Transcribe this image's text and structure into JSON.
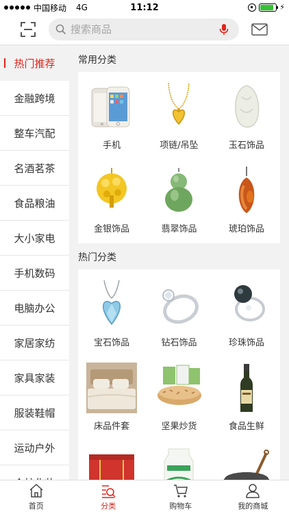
{
  "status_bar": {
    "carrier": "中国移动",
    "network": "4G",
    "time": "11:12",
    "battery_level": 0.85,
    "battery_color": "#33c233"
  },
  "header": {
    "search_placeholder": "搜索商品",
    "scan_icon": "scan-icon",
    "mic_icon": "microphone-icon",
    "message_icon": "mail-icon"
  },
  "colors": {
    "accent": "#e2231a",
    "background": "#f2f2f2"
  },
  "sidebar": {
    "items": [
      {
        "label": "热门推荐",
        "active": true
      },
      {
        "label": "金融跨境"
      },
      {
        "label": "整车汽配"
      },
      {
        "label": "名酒茗茶"
      },
      {
        "label": "食品粮油"
      },
      {
        "label": "大小家电"
      },
      {
        "label": "手机数码"
      },
      {
        "label": "电脑办公"
      },
      {
        "label": "家居家纺"
      },
      {
        "label": "家具家装"
      },
      {
        "label": "服装鞋帽"
      },
      {
        "label": "运动户外"
      },
      {
        "label": "个护化妆"
      }
    ]
  },
  "common": {
    "title": "常用分类",
    "items": [
      {
        "label": "手机",
        "icon": "smartphone-image"
      },
      {
        "label": "项链/吊坠",
        "icon": "heart-necklace-image"
      },
      {
        "label": "玉石饰品",
        "icon": "jade-pendant-image"
      },
      {
        "label": "金银饰品",
        "icon": "gold-tree-pendant-image"
      },
      {
        "label": "翡翠饰品",
        "icon": "jadeite-gourd-image"
      },
      {
        "label": "琥珀饰品",
        "icon": "amber-pendant-image"
      }
    ]
  },
  "hot": {
    "title": "热门分类",
    "items": [
      {
        "label": "宝石饰品",
        "icon": "gem-heart-pendant-image"
      },
      {
        "label": "钻石饰品",
        "icon": "diamond-ring-image"
      },
      {
        "label": "珍珠饰品",
        "icon": "pearl-ring-image"
      },
      {
        "label": "床品件套",
        "icon": "bedding-image"
      },
      {
        "label": "坚果炒货",
        "icon": "nuts-bowl-image"
      },
      {
        "label": "食品生鲜",
        "icon": "oil-bottle-image"
      },
      {
        "label": "",
        "icon": "red-storage-box-image"
      },
      {
        "label": "",
        "icon": "milk-carton-image"
      },
      {
        "label": "",
        "icon": "wok-pan-image"
      }
    ]
  },
  "tabbar": {
    "items": [
      {
        "label": "首页",
        "icon": "home-icon"
      },
      {
        "label": "分类",
        "icon": "category-icon",
        "active": true
      },
      {
        "label": "购物车",
        "icon": "cart-icon"
      },
      {
        "label": "我的商城",
        "icon": "user-icon"
      }
    ]
  }
}
